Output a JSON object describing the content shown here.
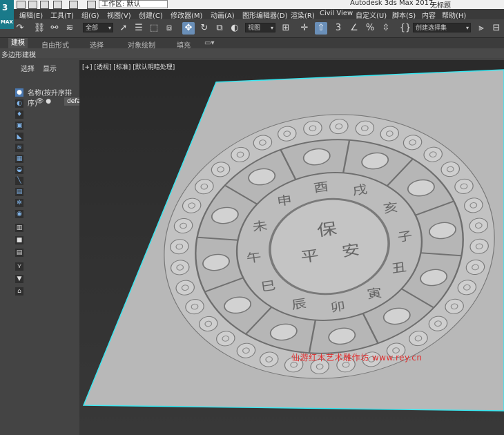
{
  "app": {
    "title": "Autodesk 3ds Max 2017",
    "doc_title": "无标题",
    "workspace": "工作区: 默认",
    "logo": "3",
    "logo_sub": "MAX"
  },
  "menu": [
    "编辑(E)",
    "工具(T)",
    "组(G)",
    "视图(V)",
    "创建(C)",
    "修改器(M)",
    "动画(A)",
    "图形编辑器(D)",
    "渲染(R)",
    "Civil View",
    "自定义(U)",
    "脚本(S)",
    "内容",
    "帮助(H)"
  ],
  "toolbar": {
    "filter": "全部",
    "coord": "视图",
    "selection_set": "创建选择集",
    "snap_label": "3"
  },
  "ribbon": {
    "tabs": [
      "建模",
      "自由形式",
      "选择",
      "对象绘制",
      "填充"
    ],
    "active": "建模",
    "sub": "多边形建模"
  },
  "scene_explorer": {
    "tabs": [
      "选择",
      "显示"
    ],
    "header": "名称(按升序排序)",
    "item": "default"
  },
  "viewport": {
    "label": "[+] [透视] [标准] [默认明暗处理]",
    "watermark": "仙游红木艺术雕作坊 www.rey.cn"
  },
  "model": {
    "inner_chars": [
      "子",
      "丑",
      "寅",
      "卯",
      "辰",
      "巳",
      "午",
      "未",
      "申",
      "酉",
      "戌",
      "亥"
    ],
    "center_chars": [
      "保",
      "平",
      "安"
    ],
    "colors": {
      "plane": "#b4b4b4",
      "relief": "#c8c8c8",
      "shadow": "#7a7a7a",
      "outline": "#38e6f0"
    }
  }
}
